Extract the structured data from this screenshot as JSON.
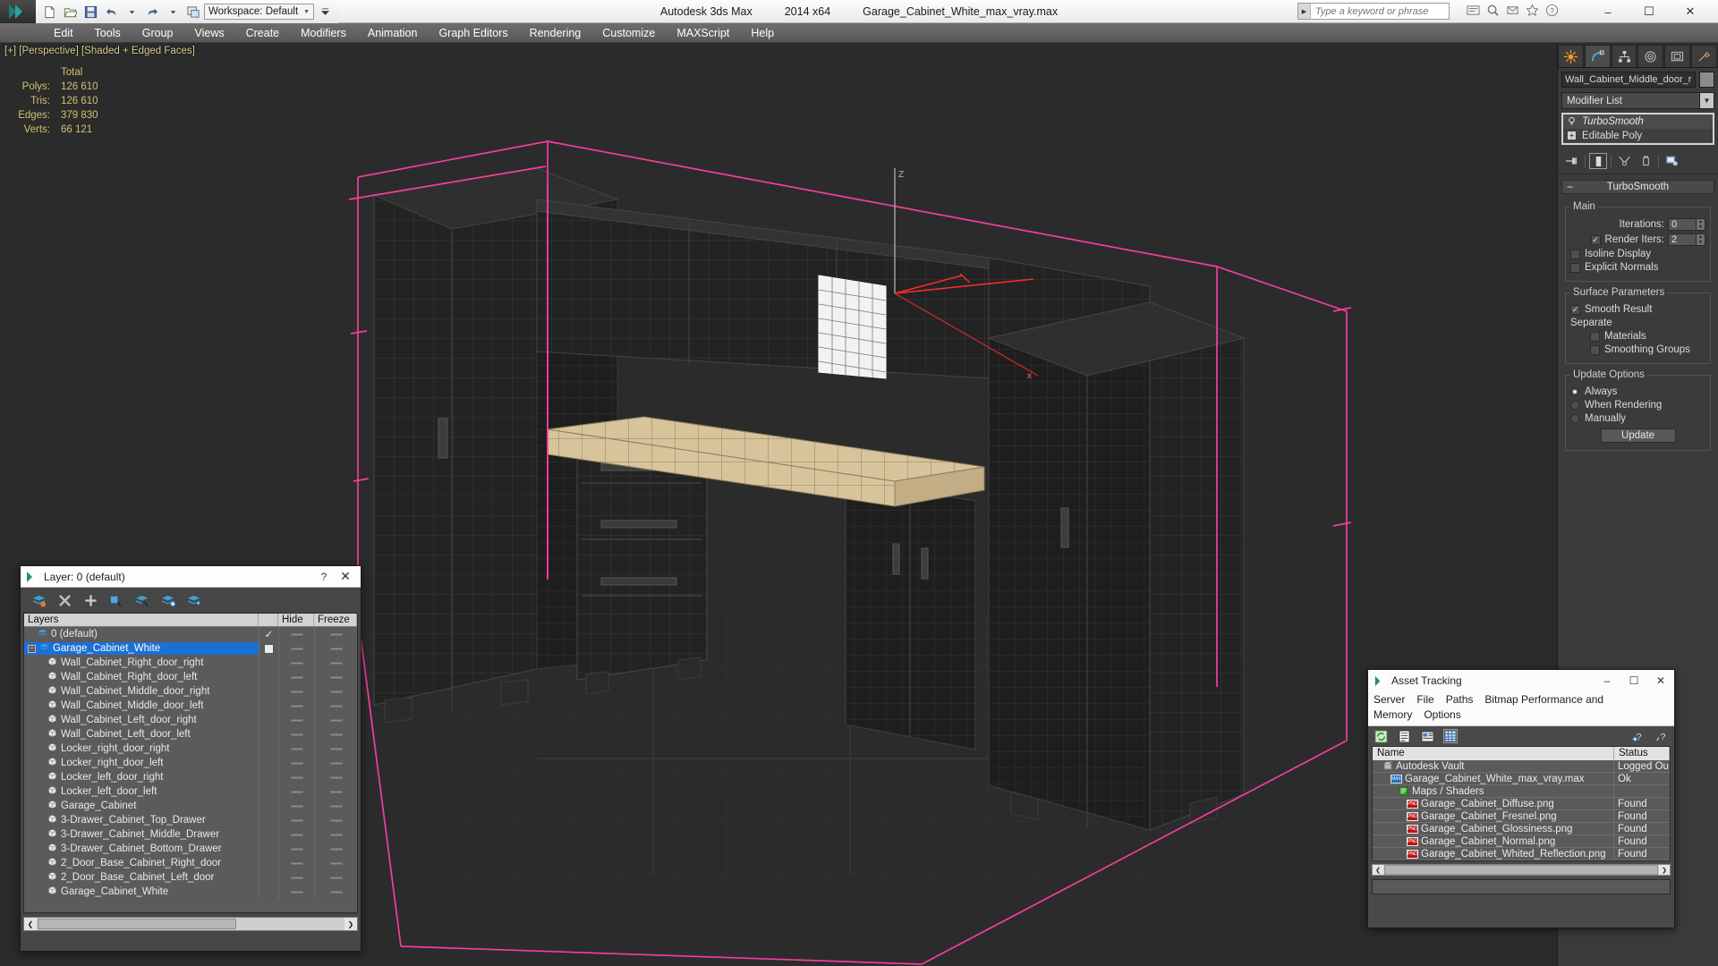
{
  "titlebar": {
    "app_title": "Autodesk 3ds Max",
    "version": "2014 x64",
    "file_name": "Garage_Cabinet_White_max_vray.max",
    "search_placeholder": "Type a keyword or phrase",
    "minimize": "–",
    "maximize": "☐",
    "close": "✕"
  },
  "quick_access": {
    "workspace_label": "Workspace: Default",
    "buttons": [
      "new-file",
      "open-file",
      "save-file",
      "undo",
      "redo",
      "set-project-folder"
    ]
  },
  "menubar": {
    "items": [
      "Edit",
      "Tools",
      "Group",
      "Views",
      "Create",
      "Modifiers",
      "Animation",
      "Graph Editors",
      "Rendering",
      "Customize",
      "MAXScript",
      "Help"
    ]
  },
  "viewport": {
    "label": "[+] [Perspective] [Shaded + Edged Faces]",
    "stats": {
      "header": "Total",
      "rows": [
        {
          "label": "Polys:",
          "value": "126 610"
        },
        {
          "label": "Tris:",
          "value": "126 610"
        },
        {
          "label": "Edges:",
          "value": "379 830"
        },
        {
          "label": "Verts:",
          "value": "66 121"
        }
      ]
    }
  },
  "command_panel": {
    "tabs": [
      "create-tab",
      "modify-tab",
      "hierarchy-tab",
      "motion-tab",
      "display-tab",
      "utilities-tab"
    ],
    "active_tab_index": 1,
    "object_name": "Wall_Cabinet_Middle_door_ri",
    "modifier_list_label": "Modifier List",
    "stack": [
      {
        "label": "TurboSmooth",
        "selected": true
      },
      {
        "label": "Editable Poly",
        "selected": false
      }
    ],
    "stack_tools": [
      "pin-stack-icon",
      "show-end-result-icon",
      "make-unique-icon",
      "remove-modifier-icon",
      "configure-modifier-sets-icon"
    ],
    "rollout": {
      "title": "TurboSmooth",
      "main_group": "Main",
      "iterations_label": "Iterations:",
      "iterations_value": "0",
      "render_iters_label": "Render Iters:",
      "render_iters_value": "2",
      "render_iters_checked": true,
      "isoline_display_label": "Isoline Display",
      "isoline_display_checked": false,
      "explicit_normals_label": "Explicit Normals",
      "explicit_normals_checked": false,
      "surface_group": "Surface Parameters",
      "smooth_result_label": "Smooth Result",
      "smooth_result_checked": true,
      "separate_label": "Separate",
      "materials_label": "Materials",
      "materials_checked": false,
      "smoothing_groups_label": "Smoothing Groups",
      "smoothing_groups_checked": false,
      "update_group": "Update Options",
      "update_options": [
        {
          "label": "Always",
          "selected": true
        },
        {
          "label": "When Rendering",
          "selected": false
        },
        {
          "label": "Manually",
          "selected": false
        }
      ],
      "update_button": "Update"
    }
  },
  "layer_dialog": {
    "title": "Layer: 0 (default)",
    "help_glyph": "?",
    "close_glyph": "✕",
    "toolbar": [
      "create-new-layer-icon",
      "delete-layer-icon",
      "add-selection-icon",
      "select-objects-in-layer-icon",
      "highlight-selected-objects-icon",
      "hide-unhide-layer-icon",
      "layer-properties-icon"
    ],
    "columns": {
      "name": "Layers",
      "select": "",
      "hide": "Hide",
      "freeze": "Freeze"
    },
    "rows": [
      {
        "name": "0 (default)",
        "indent": 1,
        "icon": "layer-icon",
        "selected": false,
        "check": "✓",
        "expander": ""
      },
      {
        "name": "Garage_Cabinet_White",
        "indent": 0,
        "icon": "layer-icon",
        "selected": true,
        "check": "box",
        "expander": "−"
      },
      {
        "name": "Wall_Cabinet_Right_door_right",
        "indent": 2,
        "icon": "object-icon",
        "selected": false,
        "check": "",
        "expander": ""
      },
      {
        "name": "Wall_Cabinet_Right_door_left",
        "indent": 2,
        "icon": "object-icon",
        "selected": false,
        "check": "",
        "expander": ""
      },
      {
        "name": "Wall_Cabinet_Middle_door_right",
        "indent": 2,
        "icon": "object-icon",
        "selected": false,
        "check": "",
        "expander": ""
      },
      {
        "name": "Wall_Cabinet_Middle_door_left",
        "indent": 2,
        "icon": "object-icon",
        "selected": false,
        "check": "",
        "expander": ""
      },
      {
        "name": "Wall_Cabinet_Left_door_right",
        "indent": 2,
        "icon": "object-icon",
        "selected": false,
        "check": "",
        "expander": ""
      },
      {
        "name": "Wall_Cabinet_Left_door_left",
        "indent": 2,
        "icon": "object-icon",
        "selected": false,
        "check": "",
        "expander": ""
      },
      {
        "name": "Locker_right_door_right",
        "indent": 2,
        "icon": "object-icon",
        "selected": false,
        "check": "",
        "expander": ""
      },
      {
        "name": "Locker_right_door_left",
        "indent": 2,
        "icon": "object-icon",
        "selected": false,
        "check": "",
        "expander": ""
      },
      {
        "name": "Locker_left_door_right",
        "indent": 2,
        "icon": "object-icon",
        "selected": false,
        "check": "",
        "expander": ""
      },
      {
        "name": "Locker_left_door_left",
        "indent": 2,
        "icon": "object-icon",
        "selected": false,
        "check": "",
        "expander": ""
      },
      {
        "name": "Garage_Cabinet",
        "indent": 2,
        "icon": "object-icon",
        "selected": false,
        "check": "",
        "expander": ""
      },
      {
        "name": "3-Drawer_Cabinet_Top_Drawer",
        "indent": 2,
        "icon": "object-icon",
        "selected": false,
        "check": "",
        "expander": ""
      },
      {
        "name": "3-Drawer_Cabinet_Middle_Drawer",
        "indent": 2,
        "icon": "object-icon",
        "selected": false,
        "check": "",
        "expander": ""
      },
      {
        "name": "3-Drawer_Cabinet_Bottom_Drawer",
        "indent": 2,
        "icon": "object-icon",
        "selected": false,
        "check": "",
        "expander": ""
      },
      {
        "name": "2_Door_Base_Cabinet_Right_door",
        "indent": 2,
        "icon": "object-icon",
        "selected": false,
        "check": "",
        "expander": ""
      },
      {
        "name": "2_Door_Base_Cabinet_Left_door",
        "indent": 2,
        "icon": "object-icon",
        "selected": false,
        "check": "",
        "expander": ""
      },
      {
        "name": "Garage_Cabinet_White",
        "indent": 2,
        "icon": "object-icon",
        "selected": false,
        "check": "",
        "expander": ""
      }
    ]
  },
  "asset_dialog": {
    "title": "Asset Tracking",
    "minimize": "–",
    "maximize": "☐",
    "close": "✕",
    "menu": [
      "Server",
      "File",
      "Paths",
      "Bitmap Performance and Memory",
      "Options"
    ],
    "toolbar": [
      "refresh-icon",
      "list-view-icon",
      "details-view-icon",
      "grid-view-icon"
    ],
    "toolbar_right": [
      "add-help-icon",
      "help-icon"
    ],
    "columns": {
      "name": "Name",
      "status": "Status"
    },
    "rows": [
      {
        "name": "Autodesk Vault",
        "status": "Logged Ou",
        "indent": 1,
        "icon": "vault-icon"
      },
      {
        "name": "Garage_Cabinet_White_max_vray.max",
        "status": "Ok",
        "indent": 2,
        "icon": "max-file-icon"
      },
      {
        "name": "Maps / Shaders",
        "status": "",
        "indent": 3,
        "icon": "maps-shaders-icon"
      },
      {
        "name": "Garage_Cabinet_Diffuse.png",
        "status": "Found",
        "indent": 4,
        "icon": "png-icon"
      },
      {
        "name": "Garage_Cabinet_Fresnel.png",
        "status": "Found",
        "indent": 4,
        "icon": "png-icon"
      },
      {
        "name": "Garage_Cabinet_Glossiness.png",
        "status": "Found",
        "indent": 4,
        "icon": "png-icon"
      },
      {
        "name": "Garage_Cabinet_Normal.png",
        "status": "Found",
        "indent": 4,
        "icon": "png-icon"
      },
      {
        "name": "Garage_Cabinet_Whited_Reflection.png",
        "status": "Found",
        "indent": 4,
        "icon": "png-icon"
      }
    ]
  },
  "colors": {
    "accent_selection": "#1c6fd4",
    "viewport_bg": "#2b2b2b",
    "stats_text": "#cfc272",
    "gizmo_pink": "#ff3fa4",
    "wood_top": "#d8c49a"
  }
}
